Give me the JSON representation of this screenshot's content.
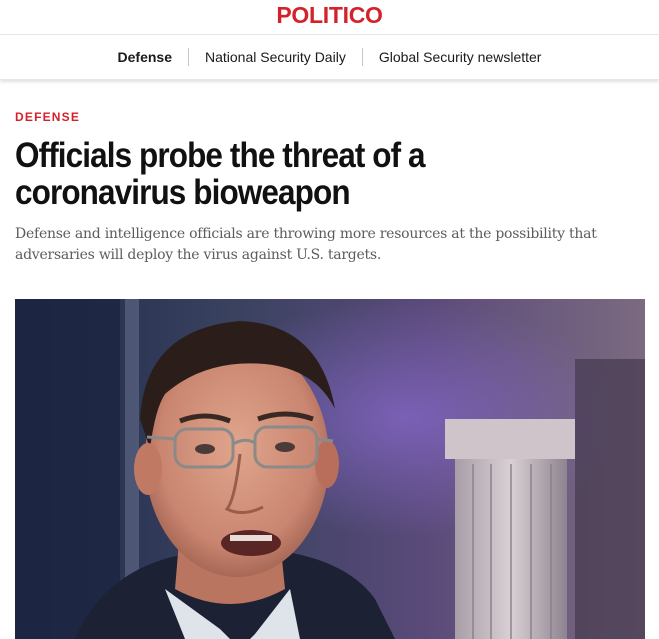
{
  "brand": {
    "logo_text": "POLITICO",
    "accent_color": "#d3222a"
  },
  "subnav": {
    "items": [
      {
        "label": "Defense",
        "active": true
      },
      {
        "label": "National Security Daily",
        "active": false
      },
      {
        "label": "Global Security newsletter",
        "active": false
      }
    ]
  },
  "article": {
    "kicker": "DEFENSE",
    "headline_line1": "Officials probe the threat of a",
    "headline_line2": "coronavirus bioweapon",
    "dek_line1": "Defense and intelligence officials are throwing more resources at the possibility that",
    "dek_line2": "adversaries will deploy the virus against U.S. targets."
  }
}
